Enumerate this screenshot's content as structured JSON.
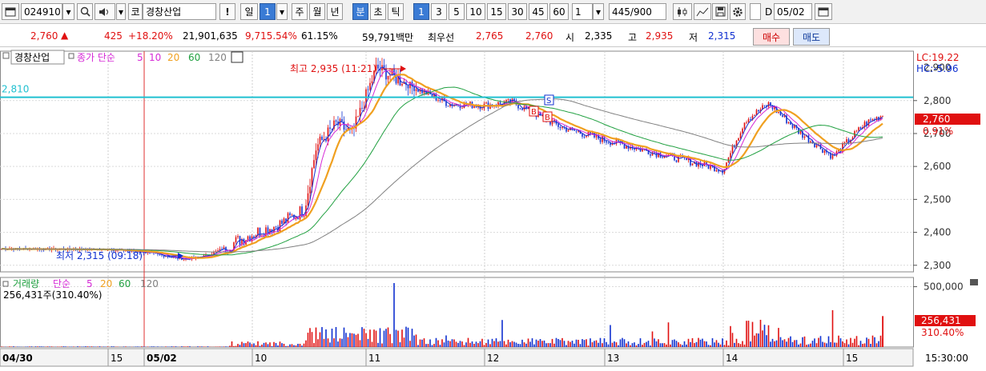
{
  "toolbar": {
    "code": "024910",
    "stock_type": "코",
    "stock_name": "경창산업",
    "alert": "!",
    "period_day": "일",
    "period_num": "1",
    "week": "주",
    "month": "월",
    "year": "년",
    "minute": "분",
    "second": "초",
    "tick": "틱",
    "intervals": [
      "1",
      "3",
      "5",
      "10",
      "15",
      "30",
      "45",
      "60"
    ],
    "interval_selected": "1",
    "count": "445",
    "count_total": "/900",
    "date_checkbox_label": "D",
    "date": "05/02"
  },
  "info": {
    "price": "2,760",
    "arrow": "▲",
    "change": "425",
    "change_pct": "+18.20%",
    "volume": "21,901,635",
    "vol_ratio": "9,715.54%",
    "turnover": "61.15%",
    "amount": "59,791백만",
    "ask_label": "최우선",
    "ask": "2,765",
    "bid": "2,760",
    "open_label": "시",
    "open": "2,335",
    "high_label": "고",
    "high": "2,935",
    "low_label": "저",
    "low": "2,315",
    "buy_label": "매수",
    "sell_label": "매도"
  },
  "price_panel": {
    "name": "경창산업",
    "ma_prefix": "종가 단순",
    "ma_periods": [
      "5",
      "10",
      "20",
      "60",
      "120"
    ],
    "high_annot": "최고 2,935 (11:21)",
    "low_annot": "최저 2,315 (09:18)",
    "hline_label": "2,810",
    "lc": "LC:19.22",
    "hc": "HC:-5.96",
    "cur_price": "2,760",
    "cur_pct": "0.91%",
    "y_ticks": [
      "2,800",
      "2,700",
      "2,600",
      "2,500",
      "2,400",
      "2,300"
    ],
    "y_partial": "2,900",
    "marker_s": "S",
    "marker_b": "B"
  },
  "volume_panel": {
    "title": "거래량",
    "ma_prefix": "단순",
    "ma_periods": [
      "5",
      "20",
      "60",
      "120"
    ],
    "value": "256,431주(310.40%)",
    "y_tick": "500,000",
    "cur_value": "256,431",
    "cur_pct": "310.40%"
  },
  "xaxis": {
    "labels": [
      "04/30",
      "15",
      "05/02",
      "10",
      "11",
      "12",
      "13",
      "14",
      "15"
    ],
    "time": "15:30:00"
  },
  "colors": {
    "up": "#e01010",
    "down": "#1030d0",
    "ma5": "#1a2fd0",
    "ma10": "#d62ad6",
    "ma20": "#f0a020",
    "ma60": "#20a040",
    "ma120": "#808080",
    "hline": "#20c0d0"
  },
  "chart_data": {
    "type": "candlestick",
    "title": "경창산업",
    "ylim": [
      2280,
      2950
    ],
    "open": 2335,
    "high": 2935,
    "low": 2315,
    "close": 2760,
    "high_time": "11:21",
    "low_time": "09:18",
    "reference_line": 2810,
    "x_labels": [
      "04/30",
      "15",
      "05/02",
      "10",
      "11",
      "12",
      "13",
      "14",
      "15"
    ],
    "close_trend": [
      {
        "t": "04/30",
        "v": 2350
      },
      {
        "t": "15",
        "v": 2348
      },
      {
        "t": "05/02 09:00",
        "v": 2340
      },
      {
        "t": "09:18",
        "v": 2318
      },
      {
        "t": "09:40",
        "v": 2330
      },
      {
        "t": "10:00",
        "v": 2395
      },
      {
        "t": "10:20",
        "v": 2425
      },
      {
        "t": "10:40",
        "v": 2470
      },
      {
        "t": "10:50",
        "v": 2660
      },
      {
        "t": "11:00",
        "v": 2730
      },
      {
        "t": "11:10",
        "v": 2700
      },
      {
        "t": "11:21",
        "v": 2900
      },
      {
        "t": "11:40",
        "v": 2860
      },
      {
        "t": "12:00",
        "v": 2790
      },
      {
        "t": "12:20",
        "v": 2785
      },
      {
        "t": "12:40",
        "v": 2795
      },
      {
        "t": "13:00",
        "v": 2720
      },
      {
        "t": "13:30",
        "v": 2680
      },
      {
        "t": "13:50",
        "v": 2640
      },
      {
        "t": "14:00",
        "v": 2590
      },
      {
        "t": "14:10",
        "v": 2740
      },
      {
        "t": "14:20",
        "v": 2790
      },
      {
        "t": "14:40",
        "v": 2700
      },
      {
        "t": "14:55",
        "v": 2630
      },
      {
        "t": "15:10",
        "v": 2730
      },
      {
        "t": "15:20",
        "v": 2760
      }
    ],
    "volume": {
      "current": 256431,
      "current_pct": 310.4,
      "ylim": [
        0,
        550000
      ]
    }
  }
}
